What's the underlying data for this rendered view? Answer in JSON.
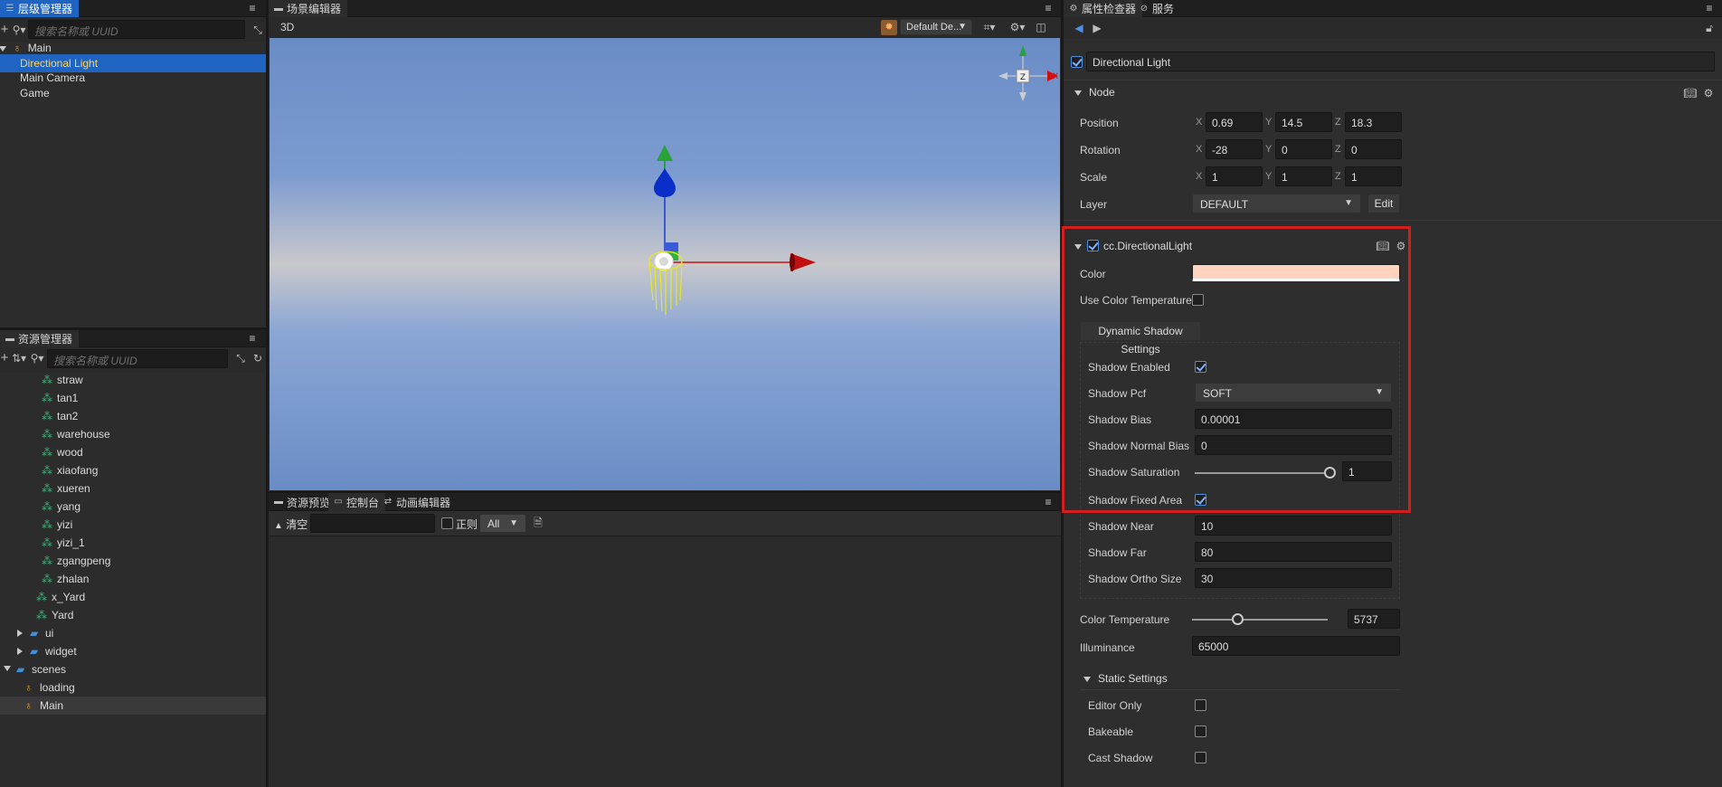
{
  "hierarchy": {
    "tab_label": "层级管理器",
    "search_placeholder": "搜索名称或 UUID",
    "nodes": [
      {
        "label": "Main"
      },
      {
        "label": "Directional Light"
      },
      {
        "label": "Main Camera"
      },
      {
        "label": "Game"
      }
    ]
  },
  "assets": {
    "tab_label": "资源管理器",
    "search_placeholder": "搜索名称或 UUID",
    "items": [
      {
        "label": "straw"
      },
      {
        "label": "tan1"
      },
      {
        "label": "tan2"
      },
      {
        "label": "warehouse"
      },
      {
        "label": "wood"
      },
      {
        "label": "xiaofang"
      },
      {
        "label": "xueren"
      },
      {
        "label": "yang"
      },
      {
        "label": "yizi"
      },
      {
        "label": "yizi_1"
      },
      {
        "label": "zgangpeng"
      },
      {
        "label": "zhalan"
      },
      {
        "label": "x_Yard"
      },
      {
        "label": "Yard"
      },
      {
        "label": "ui"
      },
      {
        "label": "widget"
      },
      {
        "label": "scenes"
      },
      {
        "label": "loading"
      },
      {
        "label": "Main"
      }
    ]
  },
  "scene": {
    "tab_label": "场景编辑器",
    "mode_label": "3D",
    "camera_select": "Default De...",
    "gizmo_center": "Z",
    "gizmo_x": "X"
  },
  "console": {
    "tabs": [
      {
        "label": "资源预览"
      },
      {
        "label": "控制台"
      },
      {
        "label": "动画编辑器"
      }
    ],
    "clear_label": "清空",
    "regex_label": "正则",
    "level_select": "All"
  },
  "inspector": {
    "tabs": [
      {
        "label": "属性检查器"
      },
      {
        "label": "服务"
      }
    ],
    "node_name": "Directional Light",
    "node_section": "Node",
    "position": {
      "label": "Position",
      "x": "0.69",
      "y": "14.5",
      "z": "18.3"
    },
    "rotation": {
      "label": "Rotation",
      "x": "-28",
      "y": "0",
      "z": "0"
    },
    "scale": {
      "label": "Scale",
      "x": "1",
      "y": "1",
      "z": "1"
    },
    "axis_labels": {
      "x": "X",
      "y": "Y",
      "z": "Z"
    },
    "layer": {
      "label": "Layer",
      "value": "DEFAULT",
      "edit_label": "Edit"
    },
    "component": {
      "name": "cc.DirectionalLight",
      "color_label": "Color",
      "color_value": "#ffd3bd",
      "use_color_temp_label": "Use Color Temperature",
      "dynamic_shadow_tab": "Dynamic Shadow Settings",
      "shadow_enabled_label": "Shadow Enabled",
      "shadow_pcf_label": "Shadow Pcf",
      "shadow_pcf_value": "SOFT",
      "shadow_bias_label": "Shadow Bias",
      "shadow_bias_value": "0.00001",
      "shadow_normal_bias_label": "Shadow Normal Bias",
      "shadow_normal_bias_value": "0",
      "shadow_saturation_label": "Shadow Saturation",
      "shadow_saturation_value": "1",
      "shadow_saturation_fraction": 1.0,
      "shadow_fixed_area_label": "Shadow Fixed Area",
      "shadow_near_label": "Shadow Near",
      "shadow_near_value": "10",
      "shadow_far_label": "Shadow Far",
      "shadow_far_value": "80",
      "shadow_ortho_label": "Shadow Ortho Size",
      "shadow_ortho_value": "30",
      "color_temp_label": "Color Temperature",
      "color_temp_value": "5737",
      "illuminance_label": "Illuminance",
      "illuminance_value": "65000",
      "static_settings_label": "Static Settings",
      "editor_only_label": "Editor Only",
      "bakeable_label": "Bakeable",
      "cast_shadow_label": "Cast Shadow"
    }
  },
  "colors": {
    "selection": "#1f64c0",
    "highlight_box": "#d11f1f",
    "folder": "#3f8fd9",
    "prefab": "#3fb47a"
  }
}
